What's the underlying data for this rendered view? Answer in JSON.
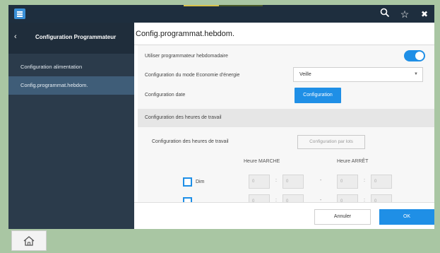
{
  "topbar": {
    "icons": [
      "menu-icon",
      "search-icon",
      "star-icon",
      "close-icon"
    ],
    "glyphs": {
      "search": "🔍",
      "star": "☆",
      "close": "✖"
    },
    "progress_fraction": 0.45
  },
  "sidebar": {
    "back_glyph": "‹",
    "title": "Configuration Programmateur",
    "items": [
      {
        "label": "Configuration alimentation",
        "active": false
      },
      {
        "label": "Config.programmat.hebdom.",
        "active": true
      }
    ]
  },
  "main": {
    "title": "Config.programmat.hebdom.",
    "use_weekly_label": "Utiliser programmateur hebdomadaire",
    "use_weekly_on": true,
    "eco_label": "Configuration du mode Economie d'énergie",
    "eco_value": "Veille",
    "date_label": "Configuration date",
    "date_button": "Configuration",
    "hours_section": "Configuration des heures de travail",
    "hours_label": "Configuration des heures de travail",
    "hours_by_batch_button": "Configuration par lots",
    "col_on": "Heure MARCHE",
    "col_off": "Heure ARRÊT",
    "rows": [
      {
        "day": "Dim",
        "on_h": "0",
        "on_m": "0",
        "off_h": "0",
        "off_m": "0"
      },
      {
        "day": "",
        "on_h": "0",
        "on_m": "0",
        "off_h": "0",
        "off_m": "0"
      }
    ]
  },
  "footer": {
    "cancel": "Annuler",
    "ok": "OK"
  },
  "bottom": {
    "home_icon": "home-icon"
  },
  "colors": {
    "accent": "#1f8fe6",
    "topbar": "#1e2e3e",
    "sidebar": "#2b3b4b",
    "sidebar_active": "#3f5d78"
  }
}
